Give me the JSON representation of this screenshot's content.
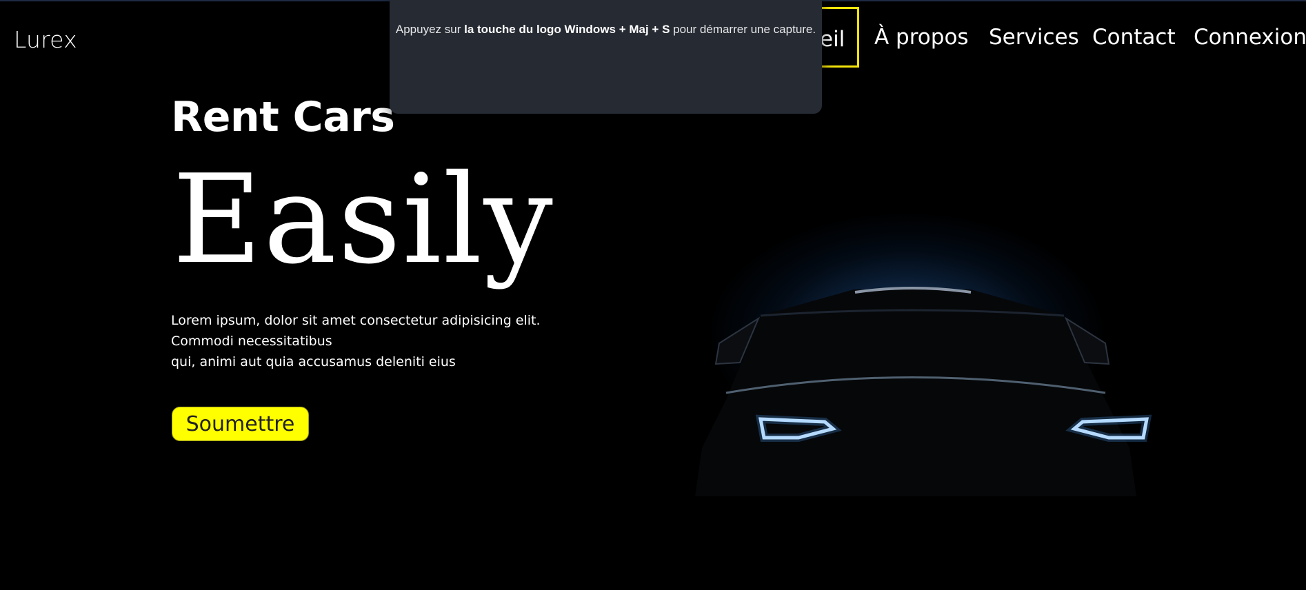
{
  "brand": {
    "name": "Lurex"
  },
  "nav": {
    "items": [
      {
        "label": "Accueil",
        "visible_label": "eil",
        "active": true
      },
      {
        "label": "À propos"
      },
      {
        "label": "Services"
      },
      {
        "label": "Contact"
      },
      {
        "label": "Connexion"
      }
    ]
  },
  "hero": {
    "subtitle": "Rent Cars",
    "title": "Easily",
    "description_line1": "Lorem ipsum, dolor sit amet consectetur adipisicing elit. Commodi necessitatibus",
    "description_line2": "qui, animi aut quia accusamus deleniti eius",
    "button_label": "Soumettre",
    "image_icon": "car-silhouette-headlights"
  },
  "toast": {
    "text_before": "Appuyez sur ",
    "text_bold": "la touche du logo Windows + Maj + S",
    "text_after": " pour démarrer une capture."
  },
  "colors": {
    "background": "#000000",
    "accent_yellow": "#ffff00",
    "nav_active_border": "#f5e50a",
    "toast_bg": "#262a33",
    "headlight_glow": "#2a6ec0"
  }
}
